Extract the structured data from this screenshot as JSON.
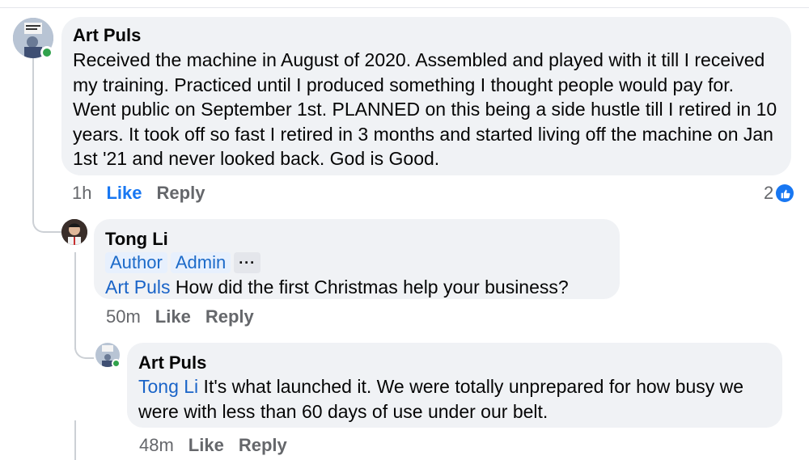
{
  "comments": [
    {
      "author": "Art Puls",
      "text": "Received  the machine in August of 2020. Assembled and played with it till I received  my training. Practiced until I produced something I thought people would pay for. Went public on September 1st. PLANNED on this being a side hustle till I retired in 10 years. It took off so fast I retired in 3 months and started living off the machine on Jan 1st '21 and never looked back. God is Good.",
      "time": "1h",
      "like": "Like",
      "reply": "Reply",
      "reaction_count": "2",
      "reaction_icon": "like-icon"
    },
    {
      "author": "Tong Li",
      "badges": [
        "Author",
        "Admin"
      ],
      "more": "···",
      "mention": "Art Puls",
      "text": " How did the first Christmas help your business?",
      "time": "50m",
      "like": "Like",
      "reply": "Reply"
    },
    {
      "author": "Art Puls",
      "mention": "Tong Li",
      "text": " It's  what launched it. We were totally unprepared for how busy we were with less than 60 days of use under our belt.",
      "time": "48m",
      "like": "Like",
      "reply": "Reply"
    }
  ],
  "colors": {
    "accent": "#1877f2",
    "bubble": "#f0f2f5",
    "online": "#31a24c",
    "mention": "#1a64c8"
  }
}
